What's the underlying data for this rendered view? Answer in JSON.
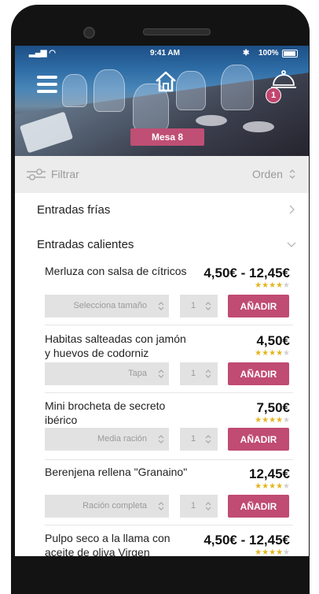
{
  "status_bar": {
    "time": "9:41 AM",
    "battery_pct": "100%"
  },
  "header": {
    "table_label": "Mesa 8",
    "cart_count": "1"
  },
  "toolbar": {
    "filter_label": "Filtrar",
    "order_label": "Orden"
  },
  "categories": [
    {
      "label": "Entradas frías"
    },
    {
      "label": "Entradas calientes"
    }
  ],
  "items": [
    {
      "name": "Merluza con salsa de cítricos",
      "price": "4,50€ - 12,45€",
      "rating": 4,
      "size": "Selecciona tamaño",
      "qty": "1",
      "add_label": "AÑADIR"
    },
    {
      "name": "Habitas salteadas con jamón y huevos de codorniz",
      "price": "4,50€",
      "rating": 4,
      "size": "Tapa",
      "qty": "1",
      "add_label": "AÑADIR"
    },
    {
      "name": "Mini brocheta de secreto ibérico",
      "price": "7,50€",
      "rating": 4,
      "size": "Media ración",
      "qty": "1",
      "add_label": "AÑADIR"
    },
    {
      "name": "Berenjena rellena \"Granaino\"",
      "price": "12,45€",
      "rating": 4,
      "size": "Ración completa",
      "qty": "1",
      "add_label": "AÑADIR"
    },
    {
      "name": "Pulpo seco a la llama con aceite de oliva Virgen",
      "price": "4,50€ - 12,45€",
      "rating": 4
    }
  ],
  "colors": {
    "accent": "#c04b73",
    "star": "#e3b51b"
  }
}
